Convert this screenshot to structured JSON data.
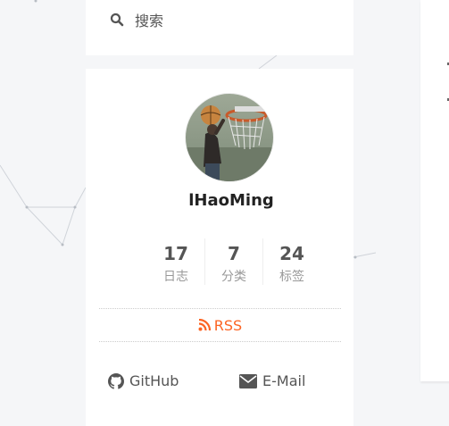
{
  "search": {
    "label": "搜索",
    "icon": "search-icon"
  },
  "author": {
    "name": "lHaoMing",
    "avatar_icon": "basketball-avatar"
  },
  "stats": [
    {
      "count": "17",
      "label": "日志"
    },
    {
      "count": "7",
      "label": "分类"
    },
    {
      "count": "24",
      "label": "标签"
    }
  ],
  "rss": {
    "label": "RSS",
    "icon": "rss-icon",
    "color": "#fc6423"
  },
  "links": {
    "github": {
      "label": "GitHub",
      "icon": "github-icon"
    },
    "email": {
      "label": "E-Mail",
      "icon": "envelope-icon"
    }
  },
  "colors": {
    "background": "#f5f6f8",
    "card": "#ffffff",
    "text": "#555555",
    "accent": "#fc6423"
  }
}
